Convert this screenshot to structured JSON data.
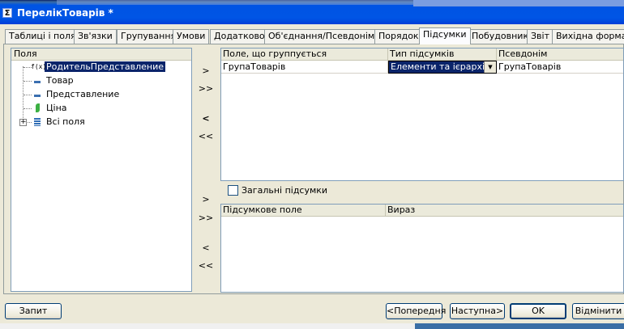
{
  "window": {
    "title": "ПерелікТоварів *"
  },
  "tabs": [
    {
      "label": "Таблиці і поля"
    },
    {
      "label": "Зв'язки"
    },
    {
      "label": "Групування"
    },
    {
      "label": "Умови"
    },
    {
      "label": "Додатково"
    },
    {
      "label": "Об'єднання/Псевдоніми"
    },
    {
      "label": "Порядок"
    },
    {
      "label": "Підсумки",
      "active": true
    },
    {
      "label": "Побудовник"
    },
    {
      "label": "Звіт"
    },
    {
      "label": "Вихідна форма"
    }
  ],
  "fields_panel": {
    "header": "Поля",
    "items": [
      {
        "label": "РодительПредставление",
        "icon": "function-icon",
        "selected": true
      },
      {
        "label": "Товар",
        "icon": "attribute-icon"
      },
      {
        "label": "Представление",
        "icon": "attribute-icon"
      },
      {
        "label": "Ціна",
        "icon": "resource-icon"
      },
      {
        "label": "Всі поля",
        "icon": "table-icon",
        "expandable": true
      }
    ]
  },
  "arrow_buttons": {
    "add": ">",
    "add_all": ">>",
    "remove": "<",
    "remove_all": "<<"
  },
  "grouping_table": {
    "columns": [
      "Поле, що группується",
      "Тип підсумків",
      "Псевдонім"
    ],
    "rows": [
      {
        "field": "ГрупаТоварів",
        "type": "Елементи та ієрархія",
        "alias": "ГрупаТоварів"
      }
    ]
  },
  "overall_totals": {
    "label": "Загальні підсумки",
    "checked": false
  },
  "totals_table": {
    "columns": [
      "Підсумкове поле",
      "Вираз"
    ]
  },
  "footer": {
    "run": "Запит",
    "prev": "<Попередня",
    "next": "Наступна>",
    "ok": "OK",
    "cancel": "Відмінити"
  }
}
